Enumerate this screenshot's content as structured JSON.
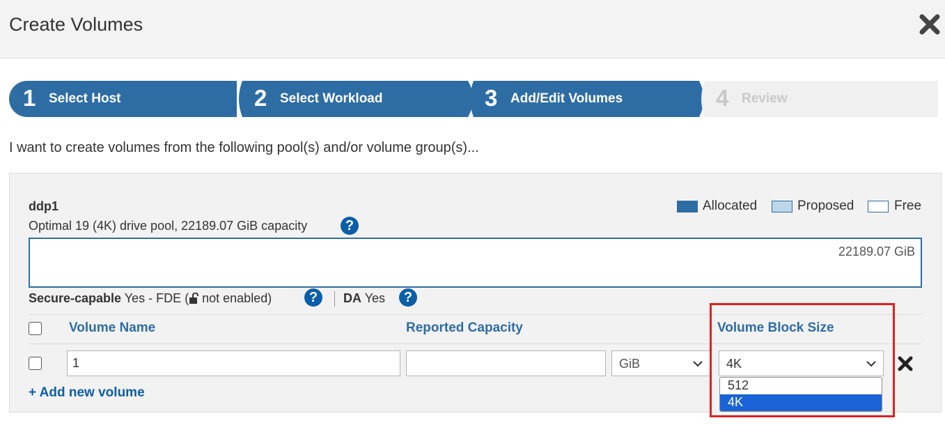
{
  "dialog": {
    "title": "Create Volumes",
    "close_icon": "close-icon"
  },
  "wizard": {
    "steps": [
      {
        "number": "1",
        "label": "Select Host",
        "state": "complete"
      },
      {
        "number": "2",
        "label": "Select Workload",
        "state": "complete"
      },
      {
        "number": "3",
        "label": "Add/Edit Volumes",
        "state": "current"
      },
      {
        "number": "4",
        "label": "Review",
        "state": "inactive"
      }
    ]
  },
  "intro_text": "I want to create volumes from the following pool(s) and/or volume group(s)...",
  "pool": {
    "name": "ddp1",
    "description": "Optimal 19 (4K) drive pool, 22189.07 GiB capacity",
    "capacity_label": "22189.07 GiB",
    "legend": [
      {
        "label": "Allocated",
        "color": "#2e6da4"
      },
      {
        "label": "Proposed",
        "color": "#bcd6ea"
      },
      {
        "label": "Free",
        "color": "#ffffff"
      }
    ],
    "secure_label": "Secure-capable",
    "secure_value_prefix": "Yes - FDE (",
    "secure_value_suffix": " not enabled)",
    "da_label": "DA",
    "da_value": "Yes"
  },
  "table": {
    "headers": {
      "volume_name": "Volume Name",
      "reported_capacity": "Reported Capacity",
      "block_size": "Volume Block Size"
    },
    "rows": [
      {
        "volume_name": "1",
        "capacity": "",
        "unit": "GiB",
        "block_size": "4K"
      }
    ],
    "add_link": "+ Add new volume"
  },
  "block_size_dropdown": {
    "options": [
      "512",
      "4K"
    ],
    "selected": "4K"
  },
  "colors": {
    "accent": "#2e6da4",
    "link": "#0b5ea8",
    "highlight": "#e02020"
  }
}
